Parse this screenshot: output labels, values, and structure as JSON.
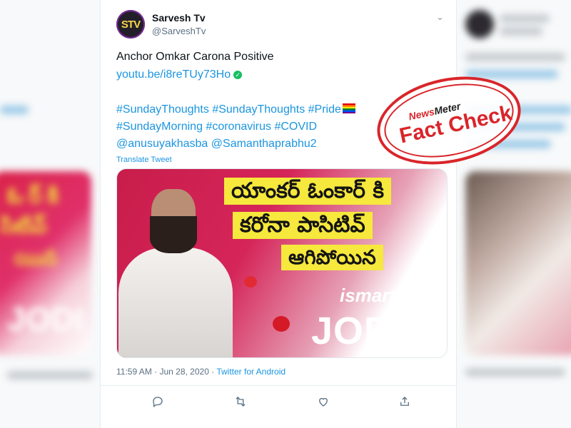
{
  "tweet": {
    "avatar_text": "STV",
    "display_name": "Sarvesh Tv",
    "handle": "@SarveshTv",
    "line1": "Anchor Omkar Carona Positive",
    "link": "youtu.be/i8reTUy73Ho",
    "verified_mark": "✓",
    "hashtags_line1": "#SundayThoughts #SundayThoughts #Pride",
    "hashtags_line2": "#SundayMorning #coronavirus #COVID",
    "mentions_line": "@anusuyakhasba @Samanthaprabhu2",
    "translate_label": "Translate Tweet",
    "timestamp": "11:59 AM · Jun 28, 2020 · ",
    "source": "Twitter for Android",
    "menu_icon": "chevron-down-icon"
  },
  "media": {
    "telugu_line1": "యాంకర్ ఓంకార్ కి",
    "telugu_line2": "కరోనా పాసిటివ్",
    "telugu_line3": "ఆగిపోయిన",
    "show_brand_small": "ismart",
    "show_brand_big": "JODI"
  },
  "stamp": {
    "brand_news": "News",
    "brand_meter": "Meter",
    "label": "Fact Check",
    "color": "#d9252a"
  },
  "actions": [
    "reply-icon",
    "retweet-icon",
    "like-icon",
    "share-icon"
  ],
  "colors": {
    "link": "#1b95e0",
    "muted": "#5b7083",
    "accent_red": "#d9252a"
  }
}
